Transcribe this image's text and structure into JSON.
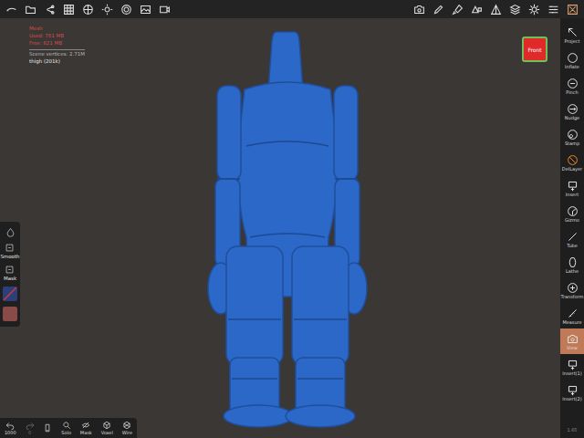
{
  "viewport": {
    "stats": [
      {
        "text": "Mesh",
        "color": "#d94a4a"
      },
      {
        "text": "Used: 761 MB",
        "color": "#d94a4a"
      },
      {
        "text": "Free: 821 MB",
        "color": "#d94a4a"
      },
      {
        "text": "Scene vertices: 2.71M",
        "color": "#b8b8b8"
      },
      {
        "text": "thigh (201k)",
        "color": "#e8e8e8"
      }
    ],
    "view_button": "Front"
  },
  "right_toolbar": [
    {
      "label": "Project",
      "selected": false
    },
    {
      "label": "Inflate",
      "selected": false
    },
    {
      "label": "Pinch",
      "selected": false
    },
    {
      "label": "Nudge",
      "selected": false
    },
    {
      "label": "Stamp",
      "selected": false
    },
    {
      "label": "DelLayer",
      "selected": false
    },
    {
      "label": "Insert",
      "selected": false
    },
    {
      "label": "Gizmo",
      "selected": false
    },
    {
      "label": "Tube",
      "selected": false
    },
    {
      "label": "Lathe",
      "selected": false
    },
    {
      "label": "Transform",
      "selected": false
    },
    {
      "label": "Measure",
      "selected": false
    },
    {
      "label": "View",
      "selected": true
    },
    {
      "label": "Insert(1)",
      "selected": false
    },
    {
      "label": "Insert(2)",
      "selected": false
    }
  ],
  "version": "1.65",
  "left_panel": {
    "items": [
      "Smooth",
      "Mask"
    ],
    "swatches": [
      {
        "color": "#2d3f7a"
      },
      {
        "color": "#8a4a48"
      }
    ]
  },
  "bottom_bar": [
    {
      "label": "1000",
      "disabled": false
    },
    {
      "label": "0",
      "disabled": true
    },
    {
      "label": "",
      "disabled": false
    },
    {
      "label": "Solo",
      "disabled": false
    },
    {
      "label": "Mask",
      "disabled": false
    },
    {
      "label": "Voxel",
      "disabled": false
    },
    {
      "label": "Wire",
      "disabled": false
    }
  ]
}
